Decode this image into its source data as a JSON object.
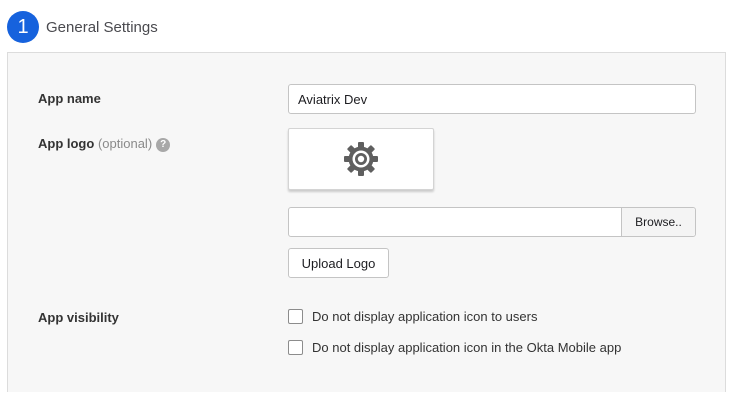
{
  "step": {
    "number": "1",
    "title": "General Settings"
  },
  "app_name": {
    "label": "App name",
    "value": "Aviatrix Dev"
  },
  "app_logo": {
    "label": "App logo",
    "optional_text": "(optional)",
    "help_icon": "question-mark-icon",
    "preview_icon": "gear-icon",
    "file_path_value": "",
    "browse_label": "Browse..",
    "upload_label": "Upload Logo"
  },
  "app_visibility": {
    "label": "App visibility",
    "options": [
      {
        "label": "Do not display application icon to users",
        "checked": false
      },
      {
        "label": "Do not display application icon in the Okta Mobile app",
        "checked": false
      }
    ]
  },
  "colors": {
    "step_badge": "#1662dd",
    "panel_background": "#f7f7f7",
    "border": "#c4c4c4"
  }
}
